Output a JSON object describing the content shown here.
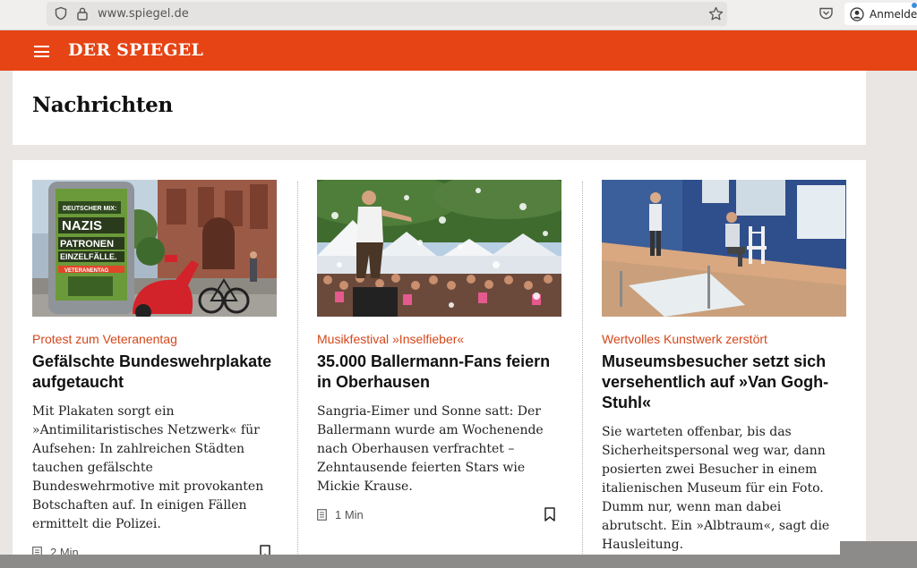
{
  "browser": {
    "url": "www.spiegel.de",
    "login_label": "Anmelden"
  },
  "site": {
    "logo": "DER SPIEGEL",
    "brand_color": "#e64415"
  },
  "section": {
    "title": "Nachrichten"
  },
  "articles": [
    {
      "kicker": "Protest zum Veteranentag",
      "headline": "Gefälschte Bundeswehrplakate aufgetaucht",
      "teaser": "Mit Plakaten sorgt ein »Antimilitaristisches Netzwerk« für Aufsehen: In zahlreichen Städten tauchen gefälschte Bundeswehrmotive mit provokanten Botschaften auf. In einigen Fällen ermittelt die Polizei.",
      "read_time": "2 Min",
      "poster_lines": [
        "DEUTSCHER MIX:",
        "NAZIS",
        "PATRONEN",
        "EINZELFÄLLE.",
        "VETERANENTAG"
      ]
    },
    {
      "kicker": "Musikfestival »Inselfieber«",
      "headline": "35.000 Ballermann-Fans feiern in Oberhausen",
      "teaser": "Sangria-Eimer und Sonne satt: Der Ballermann wurde am Wochenende nach Oberhausen verfrachtet – Zehntausende feierten Stars wie Mickie Krause.",
      "read_time": "1 Min"
    },
    {
      "kicker": "Wertvolles Kunstwerk zerstört",
      "headline": "Museumsbesucher setzt sich versehentlich auf »Van Gogh-Stuhl«",
      "teaser": "Sie warteten offenbar, bis das Sicherheitspersonal weg war, dann posierten zwei Besucher in einem italienischen Museum für ein Foto. Dumm nur, wenn man dabei abrutscht. Ein »Albtraum«, sagt die Hausleitung.",
      "read_time": "1 Min"
    }
  ],
  "icons": {
    "menu": "hamburger-menu-icon",
    "bookmark": "bookmark-icon",
    "read_time": "document-icon"
  }
}
